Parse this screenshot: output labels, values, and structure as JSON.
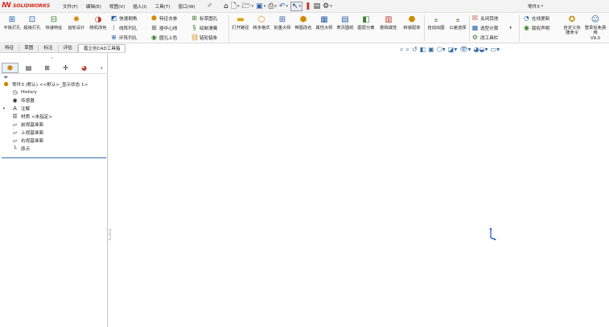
{
  "app": {
    "brand": "SOLIDWORKS",
    "doc_name": "零件3 *"
  },
  "menu": [
    "文件(F)",
    "编辑(E)",
    "视图(V)",
    "插入(I)",
    "工具(T)",
    "窗口(W)"
  ],
  "ribbon": {
    "large_buttons": [
      {
        "label": "平板打孔",
        "icon": "punch-icon",
        "color": "#1f5fa8"
      },
      {
        "label": "超级打孔",
        "icon": "punch-icon",
        "color": "#1f5fa8"
      },
      {
        "label": "快速特征",
        "icon": "feature-icon",
        "color": "#3b7d2e"
      },
      {
        "label": "齿轮设计",
        "icon": "gear-icon",
        "color": "#d08a00"
      },
      {
        "label": "随机改色",
        "icon": "color-wheel-icon",
        "color": "#c0392b"
      }
    ],
    "small_col1": [
      {
        "label": "快速倒角",
        "icon": "chamfer-icon"
      },
      {
        "label": "线阵列孔",
        "icon": "linear-array-icon"
      },
      {
        "label": "环阵列孔",
        "icon": "circular-array-icon"
      }
    ],
    "small_col2": [
      {
        "label": "特征去参",
        "icon": "cube-icon"
      },
      {
        "label": "插中心线",
        "icon": "centerline-icon"
      },
      {
        "label": "圆孔上色",
        "icon": "hole-color-icon"
      }
    ],
    "small_col3": [
      {
        "label": "标草图孔",
        "icon": "sketch-hole-icon"
      },
      {
        "label": "绘制滑簧",
        "icon": "spring-icon"
      },
      {
        "label": "链轮链条",
        "icon": "chain-icon"
      }
    ],
    "mid_buttons": [
      {
        "label": "打开路径",
        "icon": "folder-icon"
      },
      {
        "label": "转多格式",
        "icon": "convert-icon"
      },
      {
        "label": "批量大师",
        "icon": "batch-icon"
      },
      {
        "label": "带图改名",
        "icon": "rename-icon"
      },
      {
        "label": "属性大师",
        "icon": "properties-icon"
      },
      {
        "label": "表页图纸",
        "icon": "drawing-icon"
      },
      {
        "label": "图层分离",
        "icon": "layers-icon"
      },
      {
        "label": "删除属性",
        "icon": "delete-property-icon"
      },
      {
        "label": "转装配体",
        "icon": "assembly-icon"
      }
    ],
    "auto_buttons": [
      {
        "label": "自动出图",
        "icon": "auto-drawing-icon"
      },
      {
        "label": "公差选择",
        "icon": "tolerance-icon"
      }
    ],
    "right_small": [
      {
        "label": "关闭其他",
        "icon": "close-others-icon"
      },
      {
        "label": "选型计算",
        "icon": "calculator-icon"
      },
      {
        "label": "改工具栏",
        "icon": "toolbar-edit-icon"
      }
    ],
    "online": [
      {
        "label": "在线更新",
        "icon": "update-icon"
      },
      {
        "label": "版权声明",
        "icon": "copyright-icon"
      }
    ],
    "custom": {
      "label": "自定义快捷命令",
      "icon": "star-icon"
    },
    "login": {
      "label": "登录后免费用",
      "version": "V9.0",
      "icon": "login-icon"
    }
  },
  "tabs": [
    "特征",
    "草图",
    "标注",
    "评估",
    "嘉立创CAD工具箱"
  ],
  "tree": {
    "root": "零件3 (默认) <<默认>_显示状态 1>",
    "items": [
      {
        "label": "History",
        "icon": "history-icon"
      },
      {
        "label": "传感器",
        "icon": "sensor-icon"
      },
      {
        "label": "注解",
        "icon": "annotation-icon",
        "expandable": true
      },
      {
        "label": "材质 <未指定>",
        "icon": "material-icon"
      },
      {
        "label": "前视基准面",
        "icon": "plane-icon"
      },
      {
        "label": "上视基准面",
        "icon": "plane-icon"
      },
      {
        "label": "右视基准面",
        "icon": "plane-icon"
      },
      {
        "label": "原点",
        "icon": "origin-icon"
      }
    ]
  }
}
